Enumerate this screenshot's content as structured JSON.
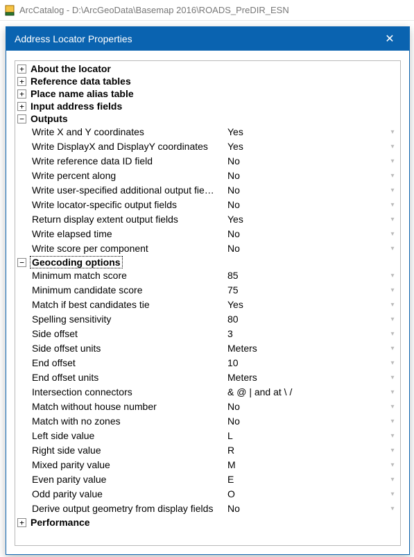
{
  "parent": {
    "title": "ArcCatalog - D:\\ArcGeoData\\Basemap 2016\\ROADS_PreDIR_ESN"
  },
  "dialog": {
    "title": "Address Locator Properties",
    "close_glyph": "✕"
  },
  "groups": {
    "about": {
      "label": "About the locator",
      "expanded": false
    },
    "refdata": {
      "label": "Reference data tables",
      "expanded": false
    },
    "placename": {
      "label": "Place name alias table",
      "expanded": false
    },
    "inputaddr": {
      "label": "Input address fields",
      "expanded": false
    },
    "outputs": {
      "label": "Outputs",
      "expanded": true
    },
    "geocoding": {
      "label": "Geocoding options",
      "expanded": true,
      "selected": true
    },
    "performance": {
      "label": "Performance",
      "expanded": false
    }
  },
  "outputs_rows": [
    {
      "k": "Write X and Y coordinates",
      "v": "Yes"
    },
    {
      "k": "Write DisplayX and DisplayY coordinates",
      "v": "Yes"
    },
    {
      "k": "Write reference data ID field",
      "v": "No"
    },
    {
      "k": "Write percent along",
      "v": "No"
    },
    {
      "k": "Write user-specified additional output fie…",
      "v": "No"
    },
    {
      "k": "Write locator-specific output fields",
      "v": "No"
    },
    {
      "k": "Return display extent output fields",
      "v": "Yes"
    },
    {
      "k": "Write elapsed time",
      "v": "No"
    },
    {
      "k": "Write score per component",
      "v": "No"
    }
  ],
  "geocoding_rows": [
    {
      "k": "Minimum match score",
      "v": "85"
    },
    {
      "k": "Minimum candidate score",
      "v": "75"
    },
    {
      "k": "Match if best candidates tie",
      "v": "Yes"
    },
    {
      "k": "Spelling sensitivity",
      "v": "80"
    },
    {
      "k": "Side offset",
      "v": "3"
    },
    {
      "k": "Side offset units",
      "v": "Meters"
    },
    {
      "k": "End offset",
      "v": "10"
    },
    {
      "k": "End offset units",
      "v": "Meters"
    },
    {
      "k": "Intersection connectors",
      "v": "& @ | and at \\ /"
    },
    {
      "k": "Match without house number",
      "v": "No"
    },
    {
      "k": "Match with no zones",
      "v": "No"
    },
    {
      "k": "Left side value",
      "v": "L"
    },
    {
      "k": "Right side value",
      "v": "R"
    },
    {
      "k": "Mixed parity value",
      "v": "M"
    },
    {
      "k": "Even parity value",
      "v": "E"
    },
    {
      "k": "Odd parity value",
      "v": "O"
    },
    {
      "k": "Derive output geometry from display fields",
      "v": "No"
    }
  ],
  "glyphs": {
    "plus": "+",
    "minus": "−",
    "chevron": "▾"
  }
}
